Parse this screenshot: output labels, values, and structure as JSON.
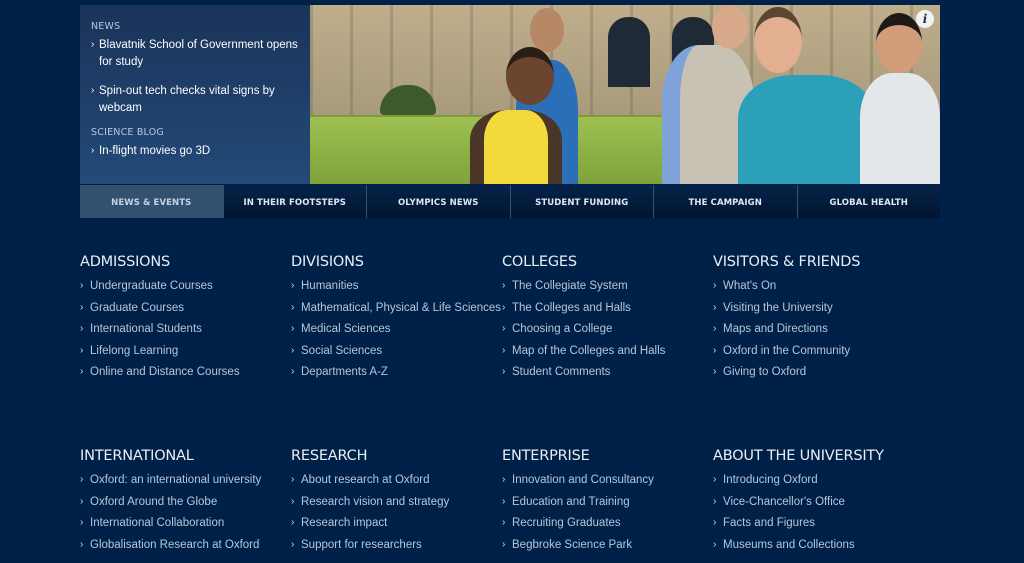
{
  "hero": {
    "news_label": "NEWS",
    "news_items": [
      {
        "label": "Blavatnik School of Government opens for study"
      },
      {
        "label": "Spin-out tech checks vital signs by webcam"
      }
    ],
    "blog_label": "SCIENCE BLOG",
    "blog_items": [
      {
        "label": "In-flight movies go 3D"
      }
    ],
    "info_icon_glyph": "i",
    "chevron": "›"
  },
  "tabs": [
    {
      "label": "NEWS & EVENTS",
      "active": true
    },
    {
      "label": "IN THEIR FOOTSTEPS",
      "active": false
    },
    {
      "label": "OLYMPICS NEWS",
      "active": false
    },
    {
      "label": "STUDENT FUNDING",
      "active": false
    },
    {
      "label": "THE CAMPAIGN",
      "active": false
    },
    {
      "label": "GLOBAL HEALTH",
      "active": false
    }
  ],
  "sections": [
    {
      "title": "ADMISSIONS",
      "links": [
        "Undergraduate Courses",
        "Graduate Courses",
        "International Students",
        "Lifelong Learning",
        "Online and Distance Courses"
      ]
    },
    {
      "title": "DIVISIONS",
      "links": [
        "Humanities",
        "Mathematical, Physical & Life Sciences",
        "Medical Sciences",
        "Social Sciences",
        "Departments A-Z"
      ]
    },
    {
      "title": "COLLEGES",
      "links": [
        "The Collegiate System",
        "The Colleges and Halls",
        "Choosing a College",
        "Map of the Colleges and Halls",
        "Student Comments"
      ]
    },
    {
      "title": "VISITORS & FRIENDS",
      "links": [
        "What's On",
        "Visiting the University",
        "Maps and Directions",
        "Oxford in the Community",
        "Giving to Oxford"
      ]
    },
    {
      "title": "INTERNATIONAL",
      "links": [
        "Oxford: an international university",
        "Oxford Around the Globe",
        "International Collaboration",
        "Globalisation Research at Oxford"
      ]
    },
    {
      "title": "RESEARCH",
      "links": [
        "About research at Oxford",
        "Research vision and strategy",
        "Research impact",
        "Support for researchers"
      ]
    },
    {
      "title": "ENTERPRISE",
      "links": [
        "Innovation and Consultancy",
        "Education and Training",
        "Recruiting Graduates",
        "Begbroke Science Park"
      ]
    },
    {
      "title": "ABOUT THE UNIVERSITY",
      "links": [
        "Introducing Oxford",
        "Vice-Chancellor's Office",
        "Facts and Figures",
        "Museums and Collections"
      ]
    }
  ],
  "colors": {
    "background": "#002147",
    "active_tab": "#32506f",
    "link_text": "#b5c6dd"
  }
}
